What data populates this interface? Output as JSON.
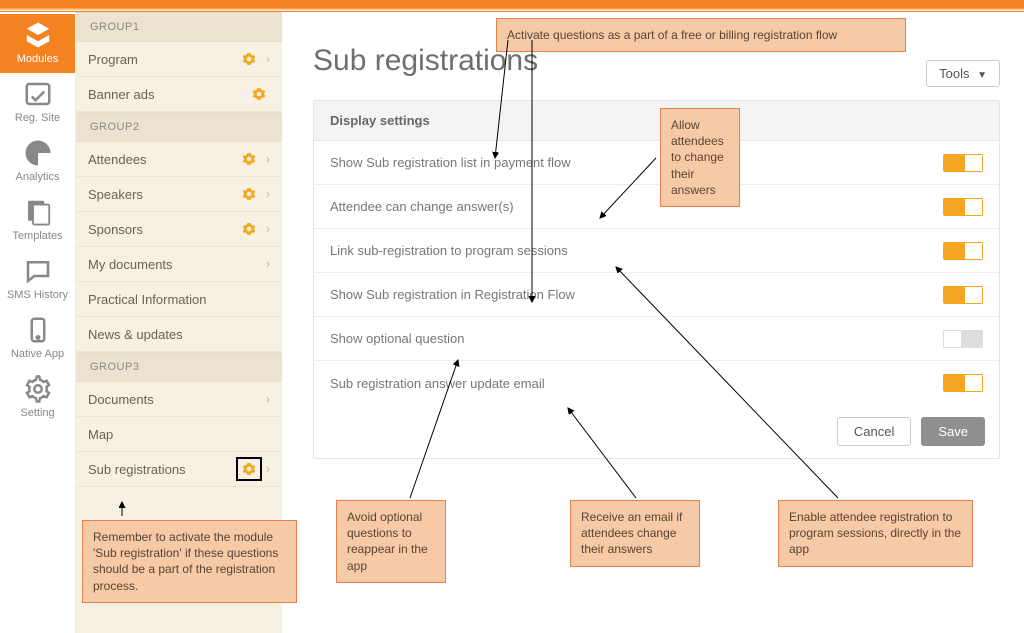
{
  "iconbar": [
    {
      "label": "Modules",
      "name": "modules",
      "active": true
    },
    {
      "label": "Reg. Site",
      "name": "reg-site",
      "active": false
    },
    {
      "label": "Analytics",
      "name": "analytics",
      "active": false
    },
    {
      "label": "Templates",
      "name": "templates",
      "active": false
    },
    {
      "label": "SMS History",
      "name": "sms-history",
      "active": false
    },
    {
      "label": "Native App",
      "name": "native-app",
      "active": false
    },
    {
      "label": "Setting",
      "name": "setting",
      "active": false
    }
  ],
  "sidebar": {
    "group1": {
      "title": "GROUP1",
      "items": [
        {
          "label": "Program",
          "gear": true,
          "chev": true
        },
        {
          "label": "Banner ads",
          "gear": true,
          "chev": false
        }
      ]
    },
    "group2": {
      "title": "GROUP2",
      "items": [
        {
          "label": "Attendees",
          "gear": true,
          "chev": true
        },
        {
          "label": "Speakers",
          "gear": true,
          "chev": true
        },
        {
          "label": "Sponsors",
          "gear": true,
          "chev": true
        },
        {
          "label": "My documents",
          "gear": false,
          "chev": true
        },
        {
          "label": "Practical Information",
          "gear": false,
          "chev": false
        },
        {
          "label": "News & updates",
          "gear": false,
          "chev": false
        }
      ]
    },
    "group3": {
      "title": "GROUP3",
      "items": [
        {
          "label": "Documents",
          "gear": false,
          "chev": true
        },
        {
          "label": "Map",
          "gear": false,
          "chev": false
        },
        {
          "label": "Sub registrations",
          "gear": true,
          "chev": true,
          "highlight_gear": true
        }
      ]
    }
  },
  "main": {
    "title": "Sub registrations",
    "tools": "Tools",
    "panel_header": "Display settings",
    "settings": [
      {
        "label": "Show Sub registration list in payment flow",
        "on": true
      },
      {
        "label": "Attendee can change answer(s)",
        "on": true
      },
      {
        "label": "Link sub-registration to program sessions",
        "on": true
      },
      {
        "label": "Show Sub registration in Registration Flow",
        "on": true
      },
      {
        "label": "Show optional question",
        "on": false
      },
      {
        "label": "Sub registration answer update email",
        "on": true
      }
    ],
    "cancel": "Cancel",
    "save": "Save"
  },
  "callouts": {
    "top": "Activate questions as a part of a free or billing registration flow",
    "allow": "Allow attendees to change their answers",
    "remember": "Remember to activate the module 'Sub registration' if these questions should be a part of the registration process.",
    "avoid": "Avoid optional questions to reappear in the app",
    "receive": "Receive an email if attendees change their answers",
    "enable": "Enable attendee registration to program sessions, directly in the app"
  }
}
